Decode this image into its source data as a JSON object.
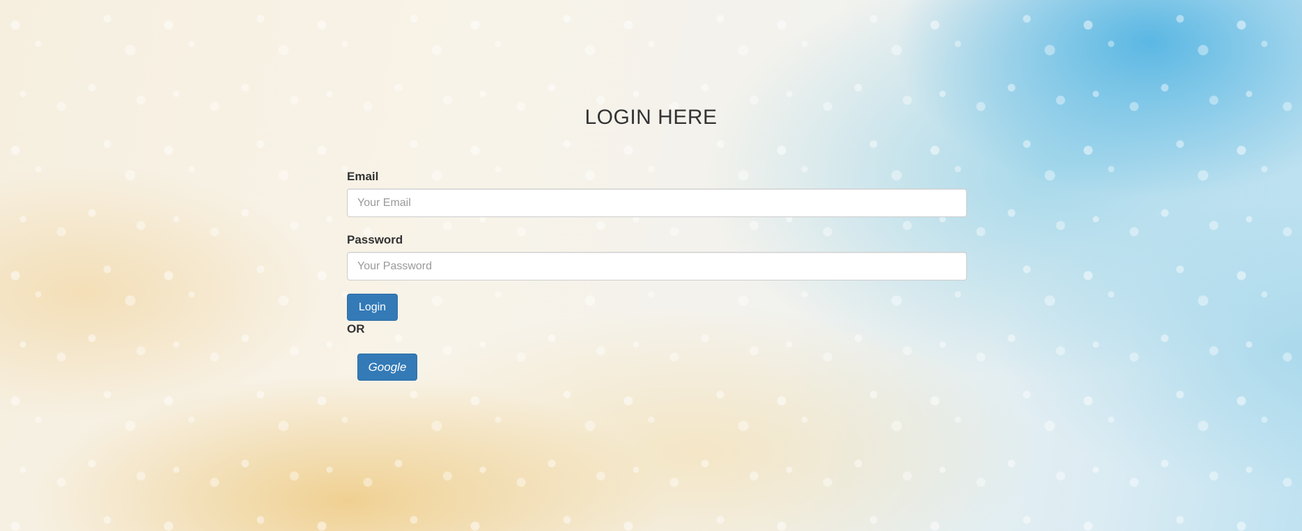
{
  "page": {
    "title": "LOGIN HERE"
  },
  "form": {
    "email_label": "Email",
    "email_placeholder": "Your Email",
    "email_value": "",
    "password_label": "Password",
    "password_placeholder": "Your Password",
    "password_value": "",
    "login_button": "Login",
    "or_text": "OR",
    "google_button": "Google"
  },
  "colors": {
    "button_primary": "#337ab7",
    "text": "#333333"
  }
}
